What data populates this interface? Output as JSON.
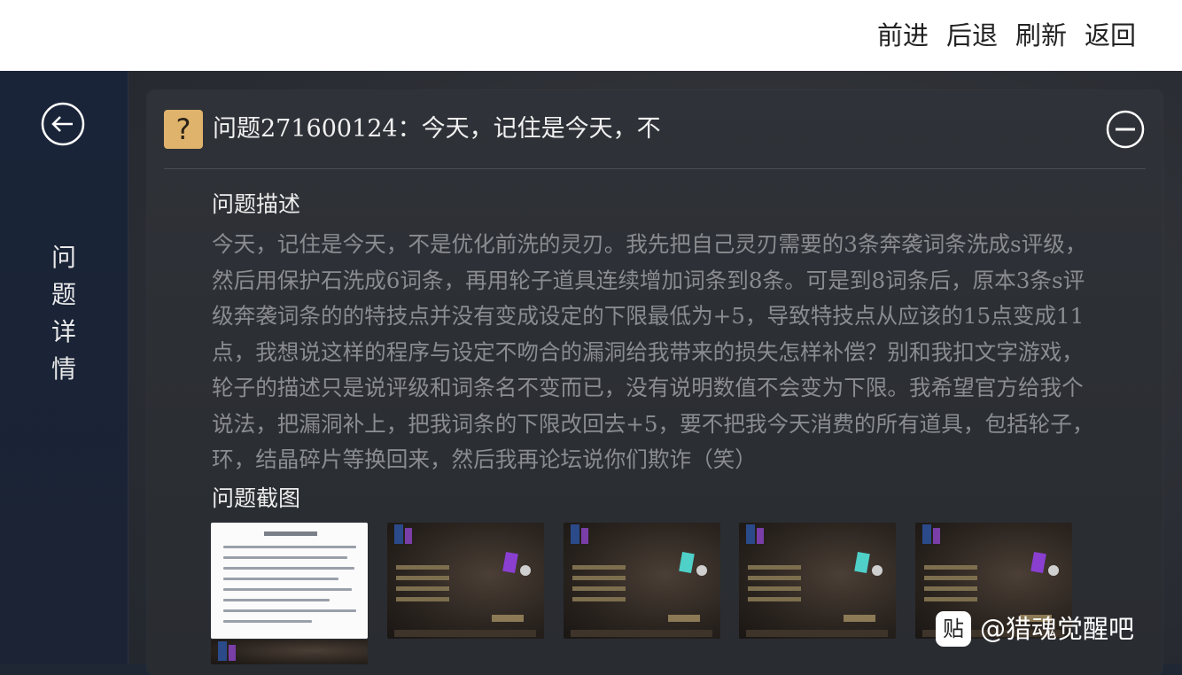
{
  "topbar": {
    "forward_label": "前进",
    "back_label": "后退",
    "refresh_label": "刷新",
    "return_label": "返回"
  },
  "sidebar": {
    "back_icon": "arrow-left-circle-icon",
    "title_chars": [
      "问",
      "题",
      "详",
      "情"
    ]
  },
  "question": {
    "icon_glyph": "?",
    "title": "问题271600124：今天，记住是今天，不",
    "collapse_icon": "minus-circle-icon",
    "description_label": "问题描述",
    "description": "今天，记住是今天，不是优化前洗的灵刃。我先把自己灵刃需要的3条奔袭词条洗成s评级，然后用保护石洗成6词条，再用轮子道具连续增加词条到8条。可是到8词条后，原本3条s评级奔袭词条的的特技点并没有变成设定的下限最低为+5，导致特技点从应该的15点变成11点，我想说这样的程序与设定不吻合的漏洞给我带来的损失怎样补偿？别和我扣文字游戏，轮子的描述只是说评级和词条名不变而已，没有说明数值不会变为下限。我希望官方给我个说法，把漏洞补上，把我词条的下限改回去+5，要不把我今天消费的所有道具，包括轮子，环，结晶碎片等换回来，然后我再论坛说你们欺诈（笑）",
    "screenshots_label": "问题截图"
  },
  "colors": {
    "accent_icon": "#dfb36c",
    "panel": "#2f3238",
    "sidebar": "#1a2438",
    "description_text": "#8a8c90"
  },
  "watermark": {
    "icon_glyph": "贴",
    "text": "@猎魂觉醒吧"
  }
}
